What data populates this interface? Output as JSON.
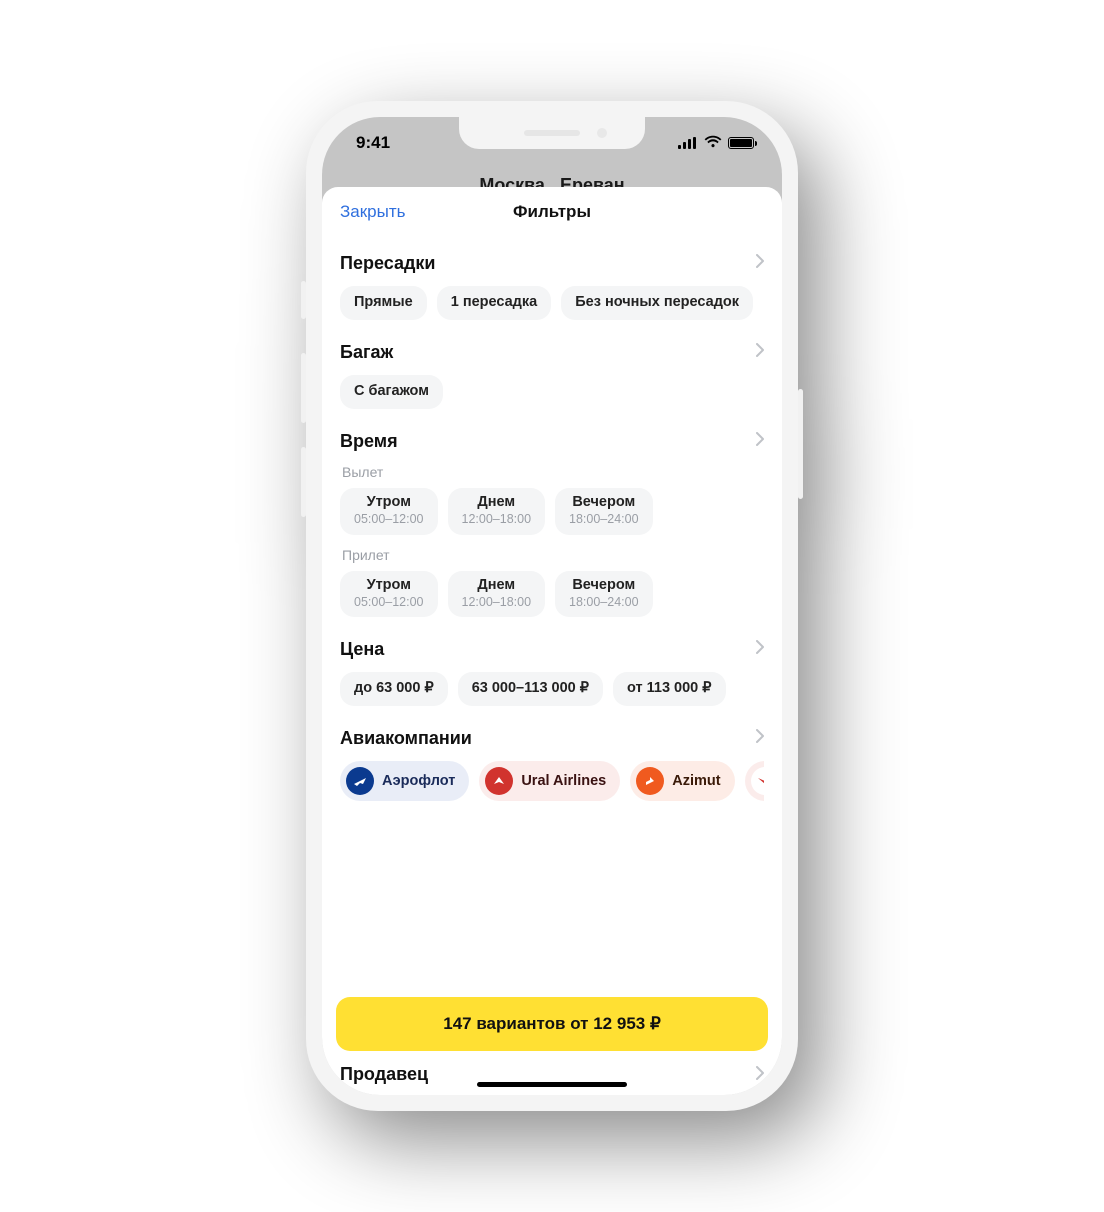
{
  "status": {
    "time": "9:41"
  },
  "background": {
    "route": "Москва   Ереван"
  },
  "sheet": {
    "close": "Закрыть",
    "title": "Фильтры"
  },
  "sections": {
    "transfers": {
      "title": "Пересадки",
      "chips": [
        "Прямые",
        "1 пересадка",
        "Без ночных пересадок"
      ]
    },
    "baggage": {
      "title": "Багаж",
      "chips": [
        "С багажом"
      ]
    },
    "time": {
      "title": "Время",
      "departure_label": "Вылет",
      "arrival_label": "Прилет",
      "slots": [
        {
          "name": "Утром",
          "range": "05:00–12:00"
        },
        {
          "name": "Днем",
          "range": "12:00–18:00"
        },
        {
          "name": "Вечером",
          "range": "18:00–24:00"
        }
      ]
    },
    "price": {
      "title": "Цена",
      "chips": [
        "до 63 000 ₽",
        "63 000–113 000 ₽",
        "от 113 000 ₽"
      ]
    },
    "airlines": {
      "title": "Авиакомпании",
      "items": [
        {
          "name": "Аэрофлот",
          "style": "blue"
        },
        {
          "name": "Ural Airlines",
          "style": "red1"
        },
        {
          "name": "Azimut",
          "style": "red2"
        }
      ]
    },
    "seller": {
      "title": "Продавец"
    }
  },
  "cta": "147 вариантов от 12 953 ₽"
}
